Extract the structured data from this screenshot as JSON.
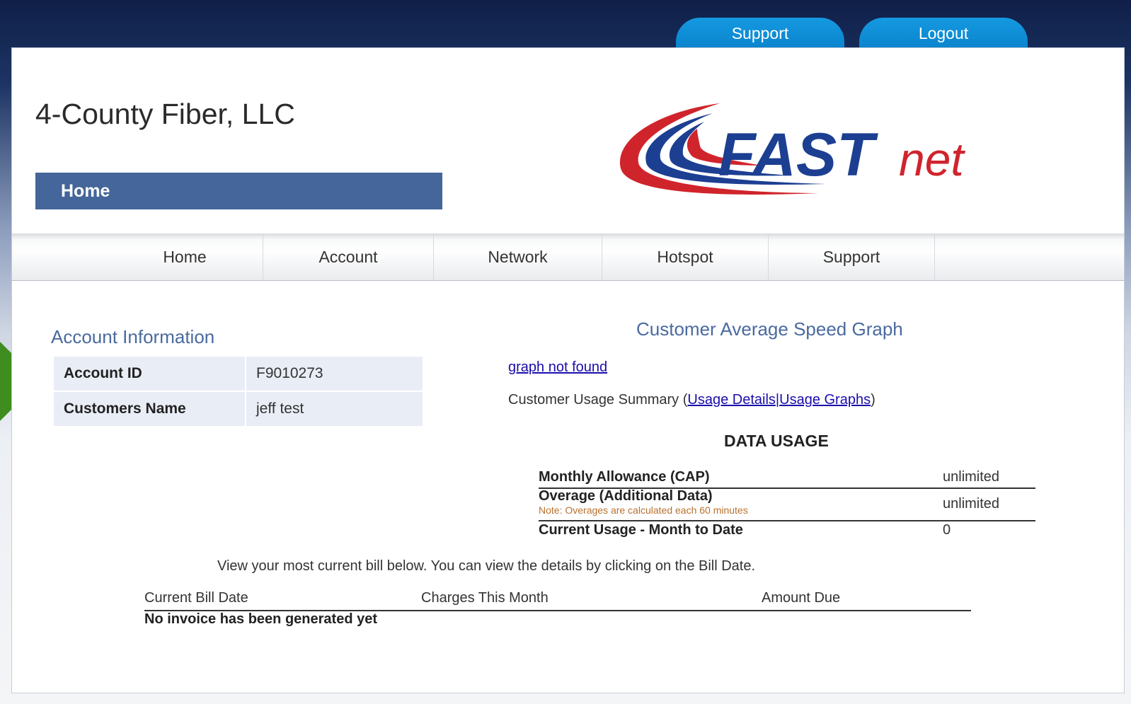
{
  "top_tabs": {
    "support": "Support",
    "logout": "Logout"
  },
  "header": {
    "company_name": "4-County Fiber, LLC",
    "section": "Home",
    "logo_text_bold": "FAST",
    "logo_text_light": "net"
  },
  "nav": [
    "Home",
    "Account",
    "Network",
    "Hotspot",
    "Support"
  ],
  "account": {
    "title": "Account Information",
    "rows": [
      {
        "label": "Account ID",
        "value": "F9010273"
      },
      {
        "label": "Customers Name",
        "value": "jeff test"
      }
    ]
  },
  "graph": {
    "title": "Customer Average Speed Graph",
    "link": "graph not found"
  },
  "summary": {
    "prefix": "Customer Usage Summary (",
    "usage_details": "Usage Details",
    "separator": "|",
    "usage_graphs": "Usage Graphs",
    "suffix": ")"
  },
  "data_usage": {
    "title": "DATA USAGE",
    "rows": [
      {
        "label": "Monthly Allowance (CAP)",
        "value": "unlimited"
      },
      {
        "label": "Overage (Additional Data)",
        "note": "Note: Overages are calculated each 60 minutes",
        "value": "unlimited"
      },
      {
        "label": "Current Usage - Month to Date",
        "value": "0"
      }
    ]
  },
  "bill": {
    "note": "View your most current bill below. You can view the details by clicking on the Bill Date.",
    "headers": [
      "Current Bill Date",
      "Charges This Month",
      "Amount Due"
    ],
    "empty": "No invoice has been generated yet"
  },
  "colors": {
    "accent": "#44669a",
    "tab": "#0b84cd",
    "arrow": "#3f8d1f",
    "link": "#1a0dab"
  }
}
